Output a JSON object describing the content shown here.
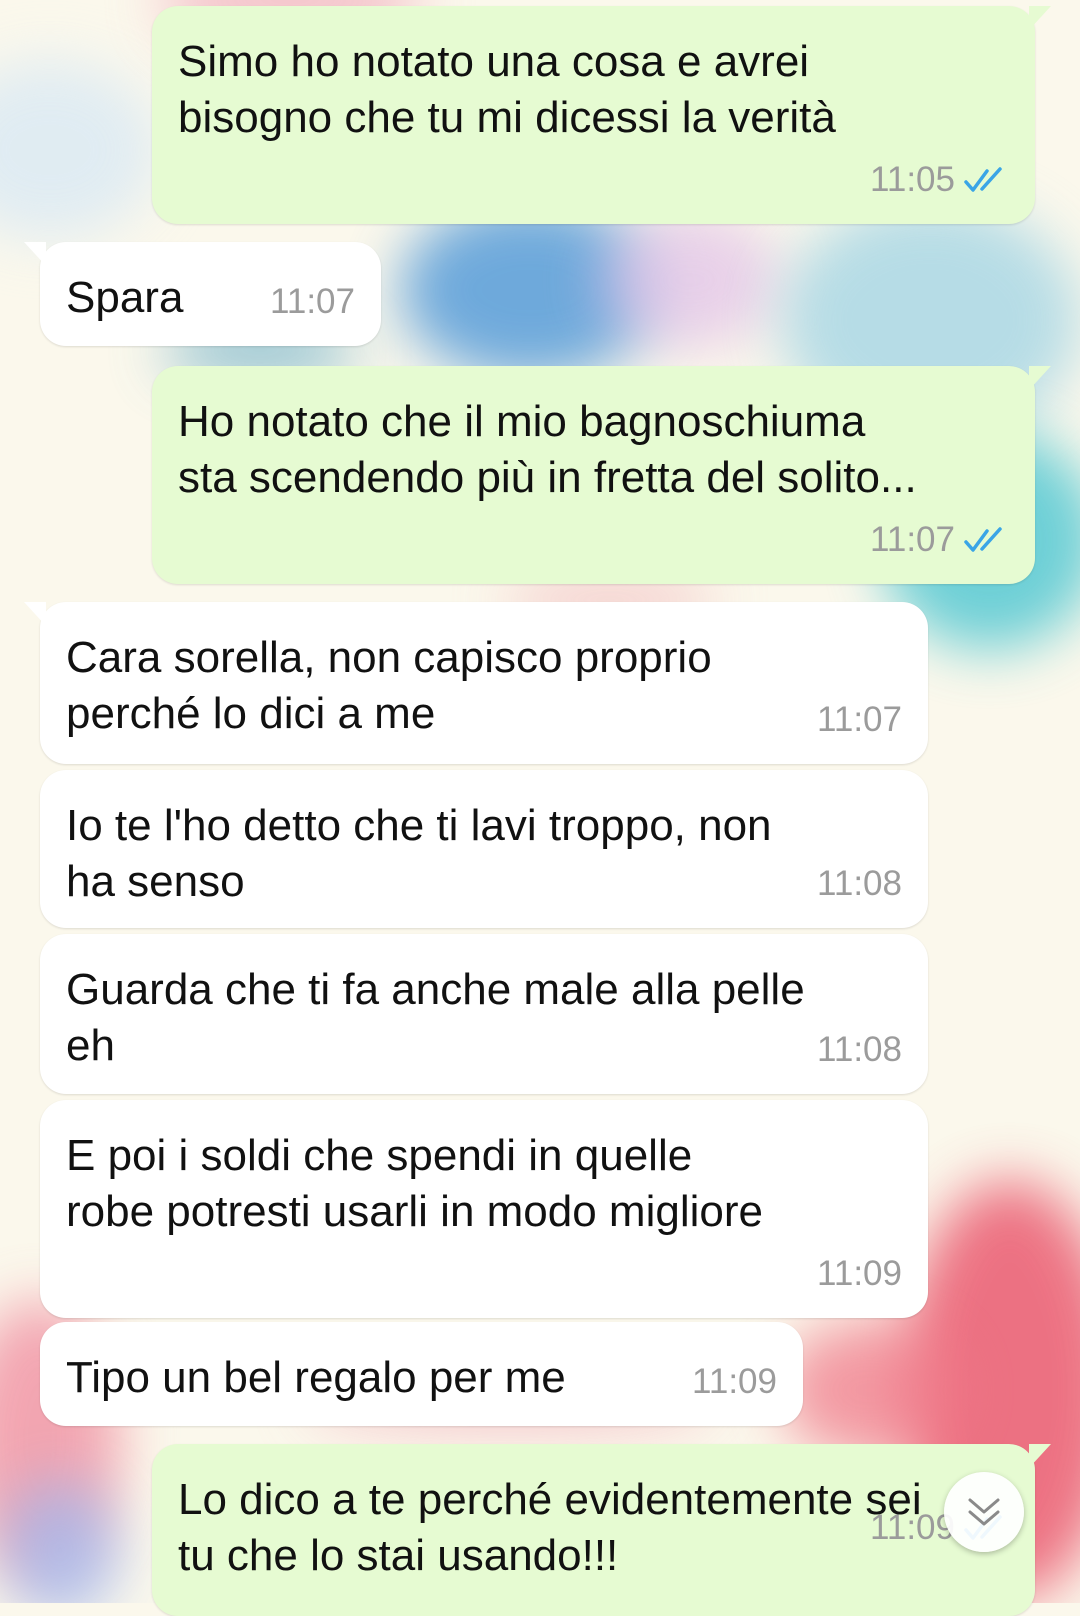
{
  "wallpaper": {
    "colors": [
      "#6fb3e0",
      "#4fc6cf",
      "#f06a7e",
      "#e8455f",
      "#c7d6f2"
    ]
  },
  "accent": {
    "read_ticks": "#3aa5e6",
    "outgoing_bubble": "#e6fbd2",
    "incoming_bubble": "#ffffff"
  },
  "messages": [
    {
      "direction": "outgoing",
      "text": "Simo ho notato una cosa e avrei\nbisogno che tu mi dicessi la verità",
      "time": "11:05",
      "status": "read",
      "status_icon": "double-check-icon"
    },
    {
      "direction": "incoming",
      "text": "Spara",
      "time": "11:07"
    },
    {
      "direction": "outgoing",
      "text": "Ho notato che il mio bagnoschiuma\nsta scendendo più in fretta del solito...",
      "time": "11:07",
      "status": "read",
      "status_icon": "double-check-icon"
    },
    {
      "direction": "incoming",
      "text": "Cara sorella, non capisco proprio\nperché lo dici a me",
      "time": "11:07"
    },
    {
      "direction": "incoming",
      "text": "Io te l'ho detto che ti lavi troppo, non\nha senso",
      "time": "11:08"
    },
    {
      "direction": "incoming",
      "text": "Guarda che ti fa anche male alla pelle\neh",
      "time": "11:08"
    },
    {
      "direction": "incoming",
      "text": "E poi i soldi che spendi in quelle\nrobe potresti usarli in modo migliore",
      "time": "11:09"
    },
    {
      "direction": "incoming",
      "text": "Tipo un bel regalo per me",
      "time": "11:09"
    },
    {
      "direction": "outgoing",
      "text": "Lo dico a te perché evidentemente sei\ntu che lo stai usando!!!",
      "time": "11:09",
      "status": "read",
      "status_icon": "double-check-icon"
    }
  ],
  "scroll_button": {
    "icon": "double-chevron-down-icon"
  }
}
